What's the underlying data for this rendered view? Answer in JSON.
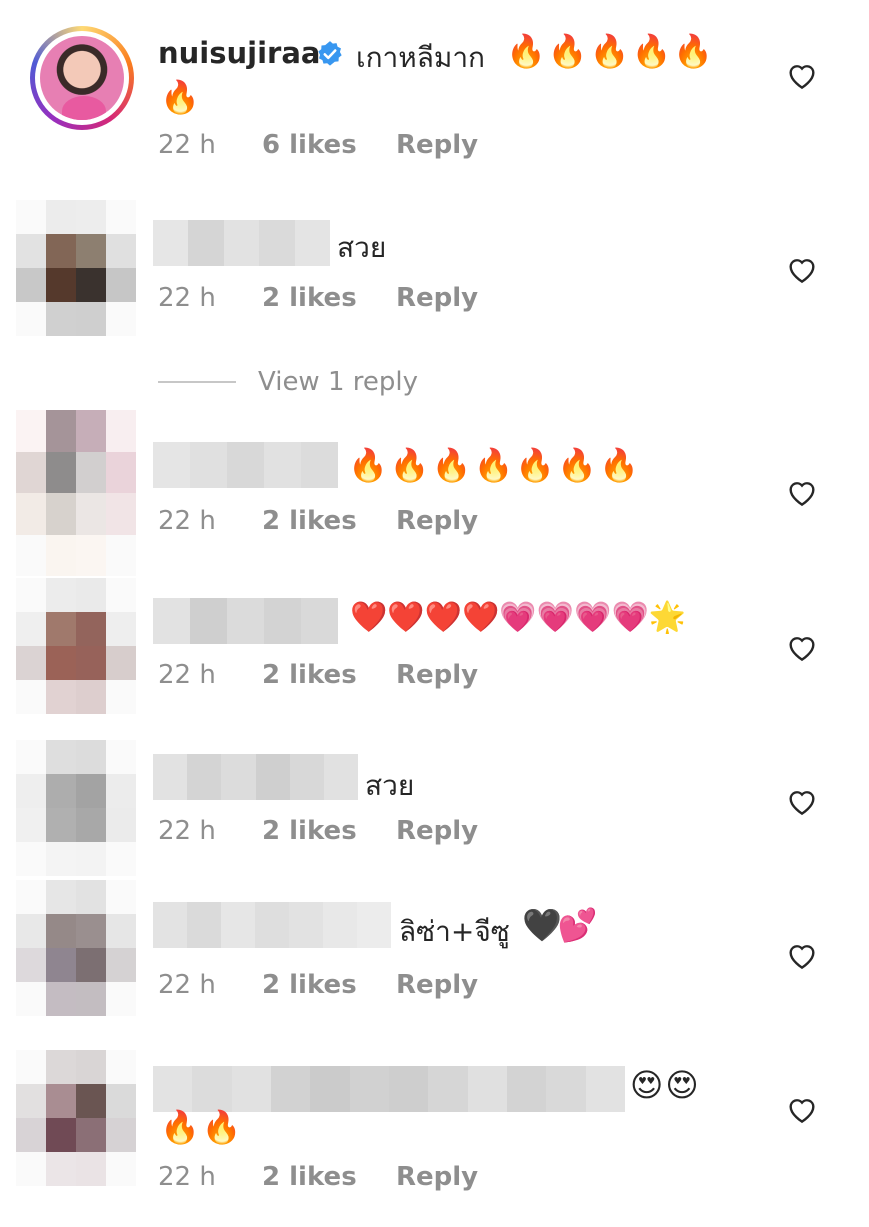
{
  "comments": [
    {
      "username": "nuisujiraa",
      "verified": true,
      "text": "เกาหลีมาก",
      "emoji": "🔥🔥🔥🔥🔥",
      "emoji_line2": "🔥",
      "time": "22 h",
      "likes": "6 likes",
      "reply": "Reply"
    },
    {
      "username": "",
      "text": "สวย",
      "emoji": "",
      "time": "22 h",
      "likes": "2 likes",
      "reply": "Reply"
    },
    {
      "username": "",
      "text": "",
      "emoji": "🔥🔥🔥🔥🔥🔥🔥",
      "time": "22 h",
      "likes": "2 likes",
      "reply": "Reply"
    },
    {
      "username": "",
      "text": "",
      "emoji": "❤️❤️❤️❤️💗💗💗💗🌟",
      "time": "22 h",
      "likes": "2 likes",
      "reply": "Reply"
    },
    {
      "username": "",
      "text": "สวย",
      "emoji": "",
      "time": "22 h",
      "likes": "2 likes",
      "reply": "Reply"
    },
    {
      "username": "",
      "text": "ลิซ่า+จีซู",
      "emoji": "🖤💕",
      "time": "22 h",
      "likes": "2 likes",
      "reply": "Reply"
    },
    {
      "username": "",
      "text": "",
      "emoji": "😍😍",
      "emoji_line2": "🔥🔥",
      "time": "22 h",
      "likes": "2 likes",
      "reply": "Reply"
    }
  ],
  "view_replies": "View 1 reply",
  "icons": {
    "like": "heart-outline-icon",
    "verified": "verified-badge-icon"
  },
  "colors": {
    "text": "#262626",
    "muted": "#8e8e8e",
    "verified": "#3897f0"
  }
}
